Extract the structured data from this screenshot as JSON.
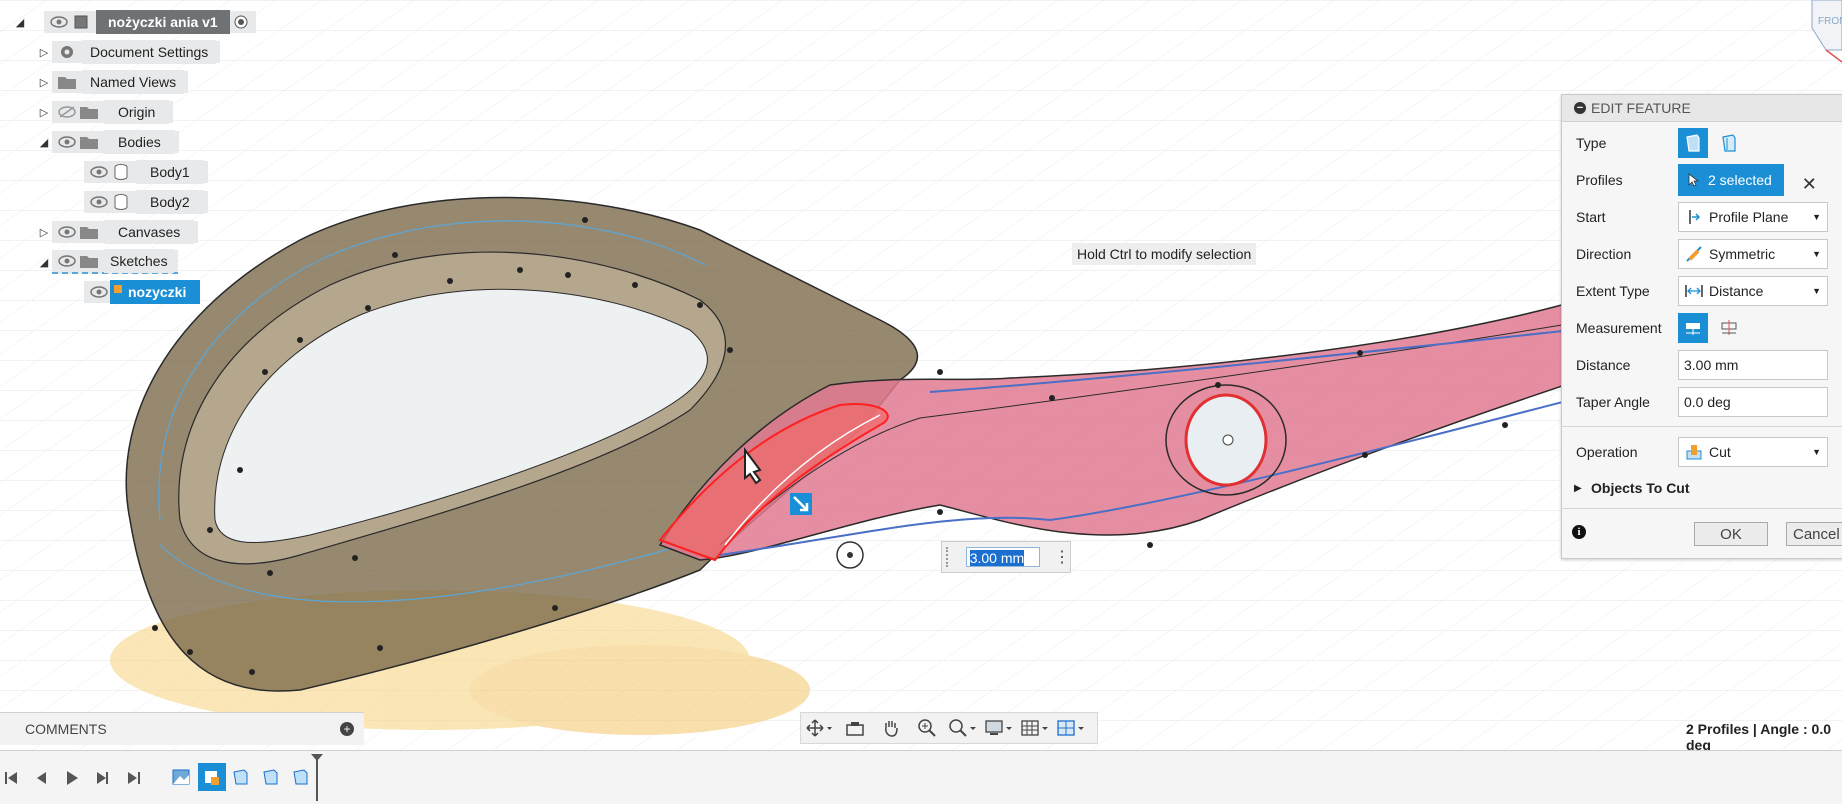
{
  "browser": {
    "root": {
      "label": "nożyczki ania v1"
    },
    "items": [
      {
        "label": "Document Settings"
      },
      {
        "label": "Named Views"
      },
      {
        "label": "Origin"
      },
      {
        "label": "Bodies"
      },
      {
        "label": "Body1"
      },
      {
        "label": "Body2"
      },
      {
        "label": "Canvases"
      },
      {
        "label": "Sketches"
      },
      {
        "label": "nozyczki"
      }
    ]
  },
  "viewcube": {
    "label": "FRONT"
  },
  "hint": "Hold Ctrl to modify selection",
  "distance_box": {
    "value": "3.00 mm"
  },
  "panel": {
    "title": "EDIT FEATURE",
    "type_label": "Type",
    "profiles_label": "Profiles",
    "profiles_value": "2 selected",
    "start_label": "Start",
    "start_value": "Profile Plane",
    "direction_label": "Direction",
    "direction_value": "Symmetric",
    "extent_label": "Extent Type",
    "extent_value": "Distance",
    "measurement_label": "Measurement",
    "distance_label": "Distance",
    "distance_value": "3.00 mm",
    "taper_label": "Taper Angle",
    "taper_value": "0.0 deg",
    "operation_label": "Operation",
    "operation_value": "Cut",
    "objects_label": "Objects To Cut",
    "ok_label": "OK",
    "cancel_label": "Cancel"
  },
  "comments": {
    "label": "COMMENTS"
  },
  "status": "2 Profiles | Angle : 0.0 deg",
  "colors": {
    "accent": "#1b8fd6",
    "body_brown": "#7a6a4a",
    "body_pink": "#e27a90",
    "shadow_yellow": "#f6d27a"
  }
}
